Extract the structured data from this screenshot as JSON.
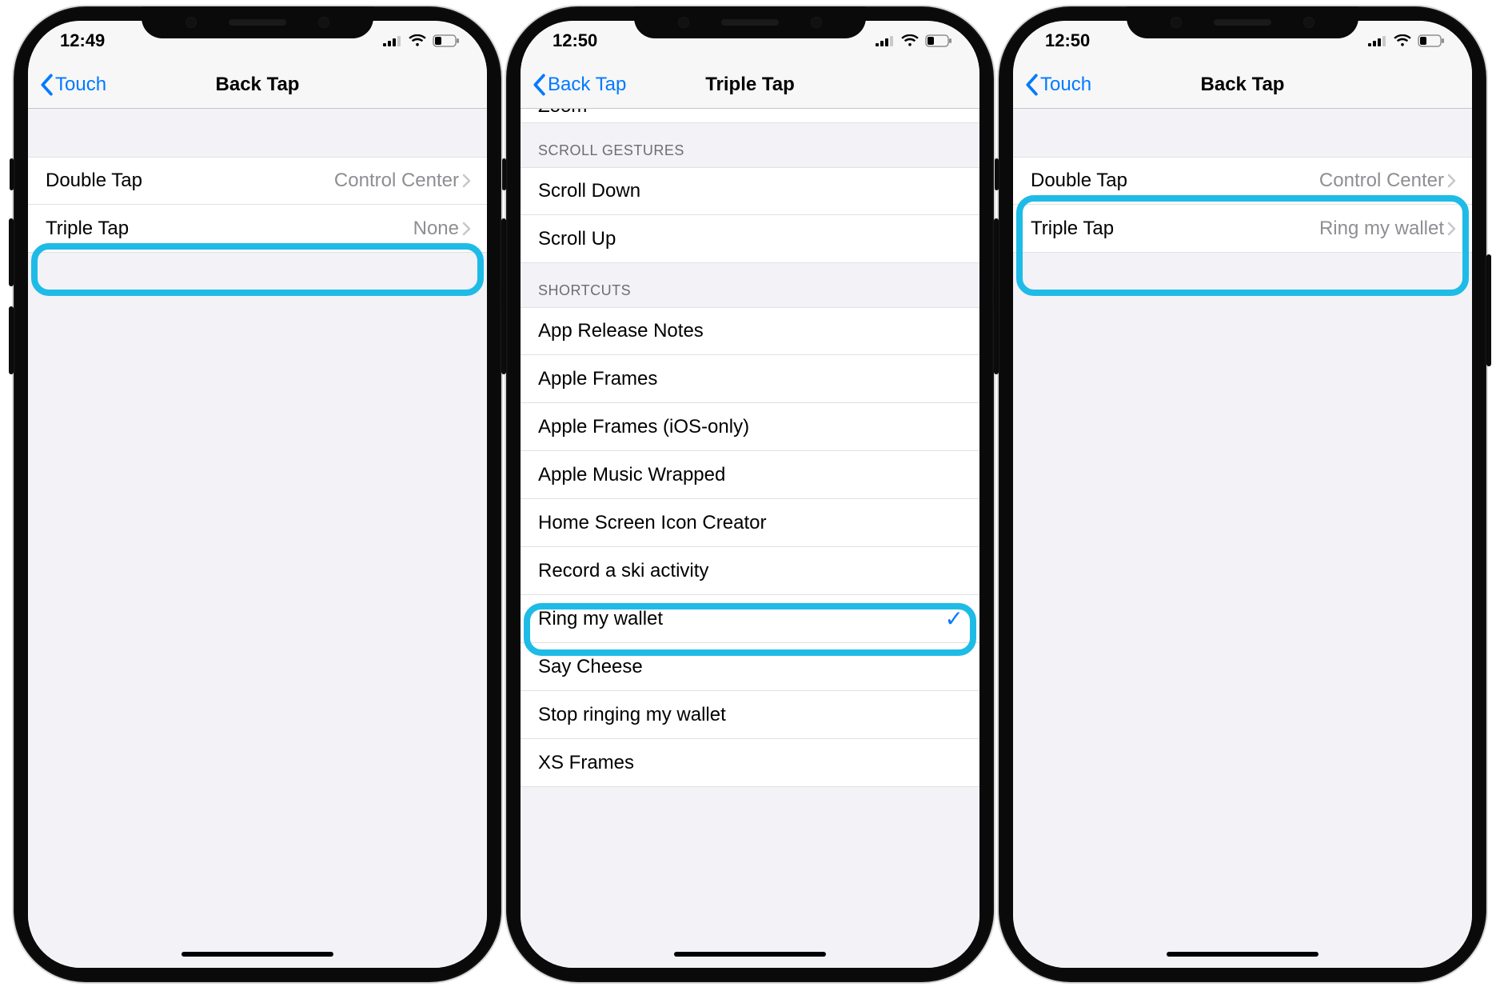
{
  "phones": [
    {
      "statusbar": {
        "time": "12:49"
      },
      "nav": {
        "back": "Touch",
        "title": "Back Tap"
      },
      "rows": [
        {
          "label": "Double Tap",
          "value": "Control Center"
        },
        {
          "label": "Triple Tap",
          "value": "None"
        }
      ],
      "highlight_row_index": 1
    },
    {
      "statusbar": {
        "time": "12:50"
      },
      "nav": {
        "back": "Back Tap",
        "title": "Triple Tap"
      },
      "clipped_label": "Zoom",
      "sections": [
        {
          "header": "Scroll Gestures",
          "items": [
            "Scroll Down",
            "Scroll Up"
          ]
        },
        {
          "header": "Shortcuts",
          "items": [
            "App Release Notes",
            "Apple Frames",
            "Apple Frames (iOS-only)",
            "Apple Music Wrapped",
            "Home Screen Icon Creator",
            "Record a ski activity",
            "Ring my wallet",
            "Say Cheese",
            "Stop ringing my wallet",
            "XS Frames"
          ]
        }
      ],
      "checked_item": "Ring my wallet"
    },
    {
      "statusbar": {
        "time": "12:50"
      },
      "nav": {
        "back": "Touch",
        "title": "Back Tap"
      },
      "rows": [
        {
          "label": "Double Tap",
          "value": "Control Center"
        },
        {
          "label": "Triple Tap",
          "value": "Ring my wallet"
        }
      ],
      "highlight_group": true
    }
  ]
}
